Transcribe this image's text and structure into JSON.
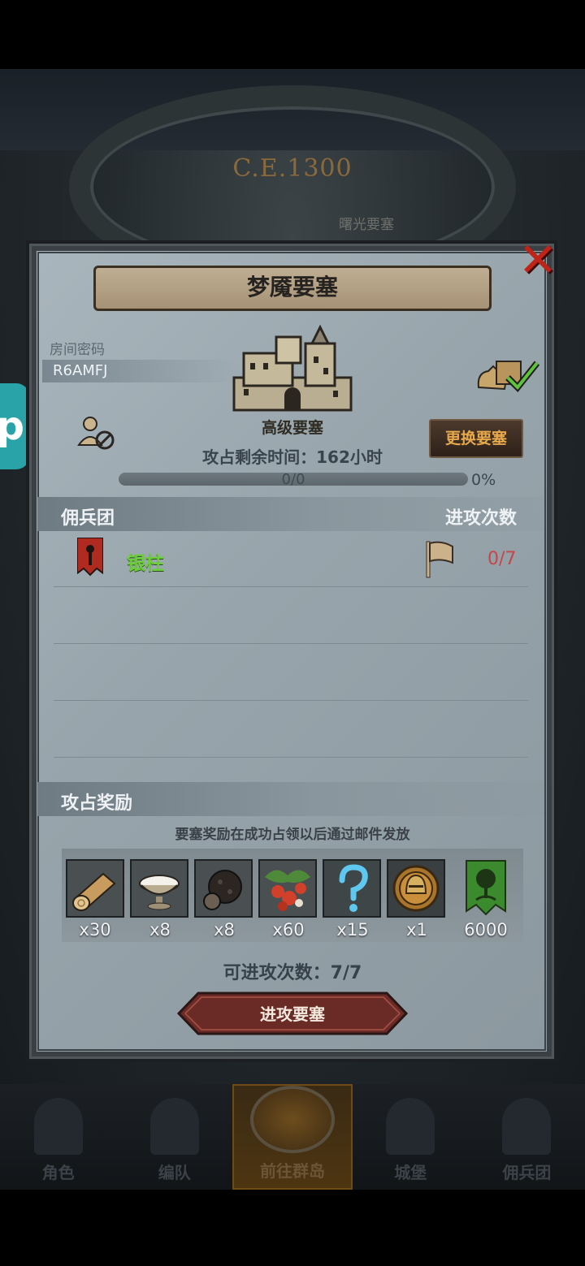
{
  "background": {
    "era_label": "C.E.1300",
    "location_label": "曙光要塞"
  },
  "dialog": {
    "title": "梦魇要塞",
    "room_password_label": "房间密码",
    "room_password_value": "R6AMFJ",
    "fortress_name": "高级要塞",
    "time_remaining": "攻占剩余时间：162小时",
    "change_button_label": "更换要塞",
    "progress_text": "0/0",
    "progress_percent_text": "0%",
    "progress_fraction": 0,
    "mercenary_header": "佣兵团",
    "attack_count_header": "进攻次数",
    "mercenaries": [
      {
        "name": "银柱",
        "attack_count": "0/7"
      }
    ],
    "rewards_header": "攻占奖励",
    "rewards_note": "要塞奖励在成功占领以后通过邮件发放",
    "rewards": [
      {
        "icon": "wood-log-icon",
        "qty": "x30"
      },
      {
        "icon": "salt-bowl-icon",
        "qty": "x8"
      },
      {
        "icon": "truffle-icon",
        "qty": "x8"
      },
      {
        "icon": "berries-icon",
        "qty": "x60"
      },
      {
        "icon": "mystery-question-icon",
        "qty": "x15"
      },
      {
        "icon": "knight-helmet-medal-icon",
        "qty": "x1"
      },
      {
        "icon": "tree-banner-icon",
        "qty": "6000"
      }
    ],
    "attempts_text": "可进攻次数：7/7",
    "attack_button_label": "进攻要塞"
  },
  "bottom_nav": {
    "items": [
      {
        "label": "角色",
        "icon": "character-icon"
      },
      {
        "label": "编队",
        "icon": "formation-icon"
      },
      {
        "label": "前往群岛",
        "icon": "compass-icon",
        "active": true
      },
      {
        "label": "城堡",
        "icon": "castle-icon"
      },
      {
        "label": "佣兵团",
        "icon": "mercenary-icon"
      }
    ]
  },
  "colors": {
    "mercenary_name": "#6cce3a",
    "attack_count": "#c8454a",
    "change_button_text": "#e8a84c",
    "close_x": "#c02318"
  }
}
